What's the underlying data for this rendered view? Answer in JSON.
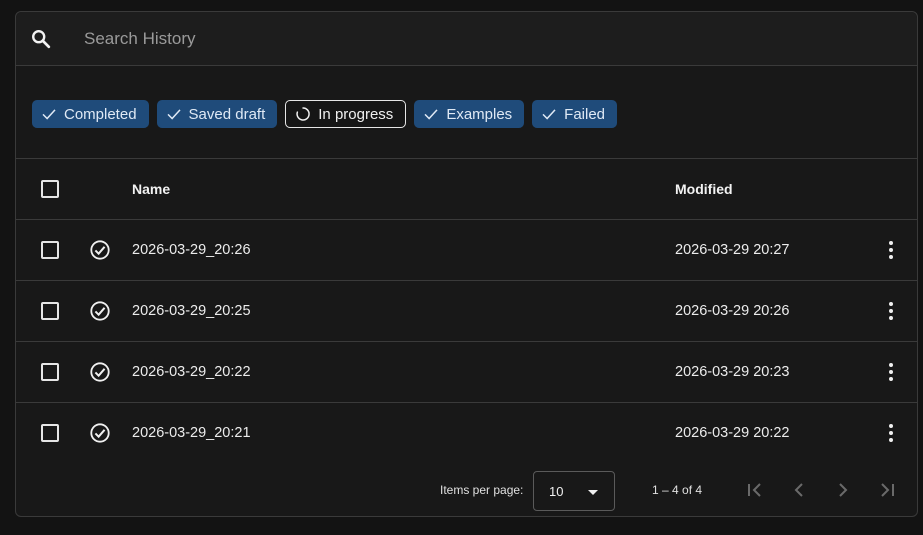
{
  "search": {
    "placeholder": "Search History",
    "value": "",
    "icon": "search-icon"
  },
  "filters": [
    {
      "label": "Completed",
      "state": "selected",
      "icon": "check-icon"
    },
    {
      "label": "Saved draft",
      "state": "selected",
      "icon": "check-icon"
    },
    {
      "label": "In progress",
      "state": "unselected",
      "icon": "spinner-icon"
    },
    {
      "label": "Examples",
      "state": "selected",
      "icon": "check-icon"
    },
    {
      "label": "Failed",
      "state": "selected",
      "icon": "check-icon"
    }
  ],
  "table": {
    "columns": {
      "name": "Name",
      "modified": "Modified"
    },
    "rows": [
      {
        "name": "2026-03-29_20:26",
        "modified": "2026-03-29 20:27",
        "status_icon": "check-circle-icon"
      },
      {
        "name": "2026-03-29_20:25",
        "modified": "2026-03-29 20:26",
        "status_icon": "check-circle-icon"
      },
      {
        "name": "2026-03-29_20:22",
        "modified": "2026-03-29 20:23",
        "status_icon": "check-circle-icon"
      },
      {
        "name": "2026-03-29_20:21",
        "modified": "2026-03-29 20:22",
        "status_icon": "check-circle-icon"
      }
    ]
  },
  "paginator": {
    "items_per_page_label": "Items per page:",
    "page_size": "10",
    "range_label": "1 – 4 of 4"
  },
  "colors": {
    "chip_selected_bg": "#1f4b7a",
    "background": "#131313",
    "border": "#3a3a3a"
  }
}
